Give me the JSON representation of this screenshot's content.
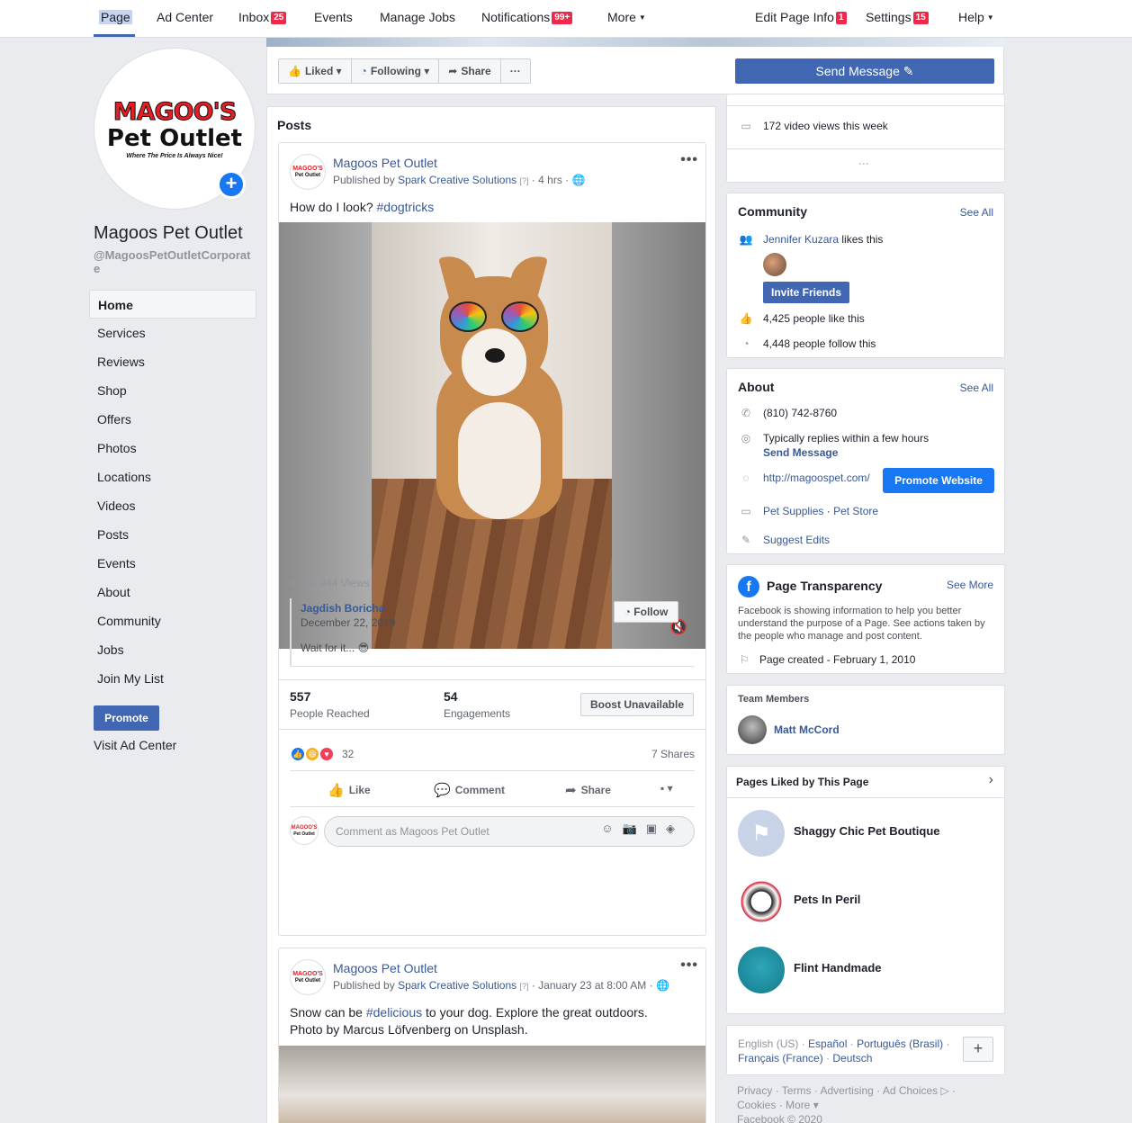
{
  "topbar": {
    "left": [
      {
        "label": "Page"
      },
      {
        "label": "Ad Center"
      },
      {
        "label": "Inbox",
        "badge": "25"
      },
      {
        "label": "Events"
      },
      {
        "label": "Manage Jobs"
      },
      {
        "label": "Notifications",
        "badge": "99+"
      },
      {
        "label": "More"
      }
    ],
    "right": [
      {
        "label": "Edit Page Info",
        "badge": "1"
      },
      {
        "label": "Settings",
        "badge": "15"
      },
      {
        "label": "Help"
      }
    ]
  },
  "profile": {
    "logo_top": "MAGOO'S",
    "logo_mid": "Pet Outlet",
    "logo_tagline": "Where The Price Is Always Nice!",
    "name": "Magoos Pet Outlet",
    "handle": "@MagoosPetOutletCorporate"
  },
  "nav": [
    "Home",
    "Services",
    "Reviews",
    "Shop",
    "Offers",
    "Photos",
    "Locations",
    "Videos",
    "Posts",
    "Events",
    "About",
    "Community",
    "Jobs",
    "Join My List"
  ],
  "promote_label": "Promote",
  "visit_ad_center": "Visit Ad Center",
  "actionbar": {
    "liked": "Liked",
    "following": "Following",
    "share": "Share",
    "more": "···",
    "send_message": "Send Message"
  },
  "posts_title": "Posts",
  "post1": {
    "author": "Magoos Pet Outlet",
    "published_by_prefix": "Published by",
    "publisher": "Spark Creative Solutions",
    "qmark": "[?]",
    "time": "· 4 hrs ·",
    "text_prefix": "How do I look?",
    "hashtag": "#dogtricks",
    "views": "9,529,944 Views",
    "credit_name": "Jagdish Boricha",
    "credit_date": "December 22, 2019",
    "credit_text": "Wait for it... 😎",
    "follow": "Follow",
    "reached_num": "557",
    "reached_lbl": "People Reached",
    "engage_num": "54",
    "engage_lbl": "Engagements",
    "boost": "Boost Unavailable",
    "reactions": "32",
    "shares": "7 Shares",
    "like": "Like",
    "comment": "Comment",
    "share": "Share",
    "comment_placeholder": "Comment as Magoos Pet Outlet"
  },
  "post2": {
    "author": "Magoos Pet Outlet",
    "published_by_prefix": "Published by",
    "publisher": "Spark Creative Solutions",
    "qmark": "[?]",
    "time": "· January 23 at 8:00 AM ·",
    "text1_prefix": "Snow can be",
    "hashtag": "#delicious",
    "text1_suffix": "to your dog. Explore the great outdoors.",
    "text2": "Photo by Marcus Löfvenberg on Unsplash."
  },
  "videos_card": {
    "views": "172 video views this week",
    "more": "···"
  },
  "community": {
    "title": "Community",
    "see_all": "See All",
    "liker": "Jennifer Kuzara",
    "likes_this": "likes this",
    "invite": "Invite Friends",
    "likes": "4,425 people like this",
    "follows": "4,448 people follow this"
  },
  "about": {
    "title": "About",
    "see_all": "See All",
    "phone": "(810) 742-8760",
    "reply": "Typically replies within a few hours",
    "send_message": "Send Message",
    "website": "http://magoospet.com/",
    "promote_website": "Promote Website",
    "category1": "Pet Supplies",
    "category2": "Pet Store",
    "suggest": "Suggest Edits"
  },
  "transparency": {
    "title": "Page Transparency",
    "see_more": "See More",
    "desc": "Facebook is showing information to help you better understand the purpose of a Page. See actions taken by the people who manage and post content.",
    "created": "Page created - February 1, 2010"
  },
  "team": {
    "title": "Team Members",
    "member": "Matt McCord"
  },
  "liked_pages": {
    "title": "Pages Liked by This Page",
    "pages": [
      "Shaggy Chic Pet Boutique",
      "Pets In Peril",
      "Flint Handmade"
    ]
  },
  "footer": {
    "lang_current": "English (US)",
    "langs": [
      "Español",
      "Português (Brasil)",
      "Français (France)",
      "Deutsch"
    ],
    "links_line1": "Privacy · Terms · Advertising · Ad Choices ▷ ·",
    "links_line2": "Cookies · More ▾",
    "copyright": "Facebook © 2020"
  },
  "colors": {
    "brand": "#4267b2",
    "link": "#385898",
    "badge": "#f02849",
    "background": "#e9ebee"
  }
}
